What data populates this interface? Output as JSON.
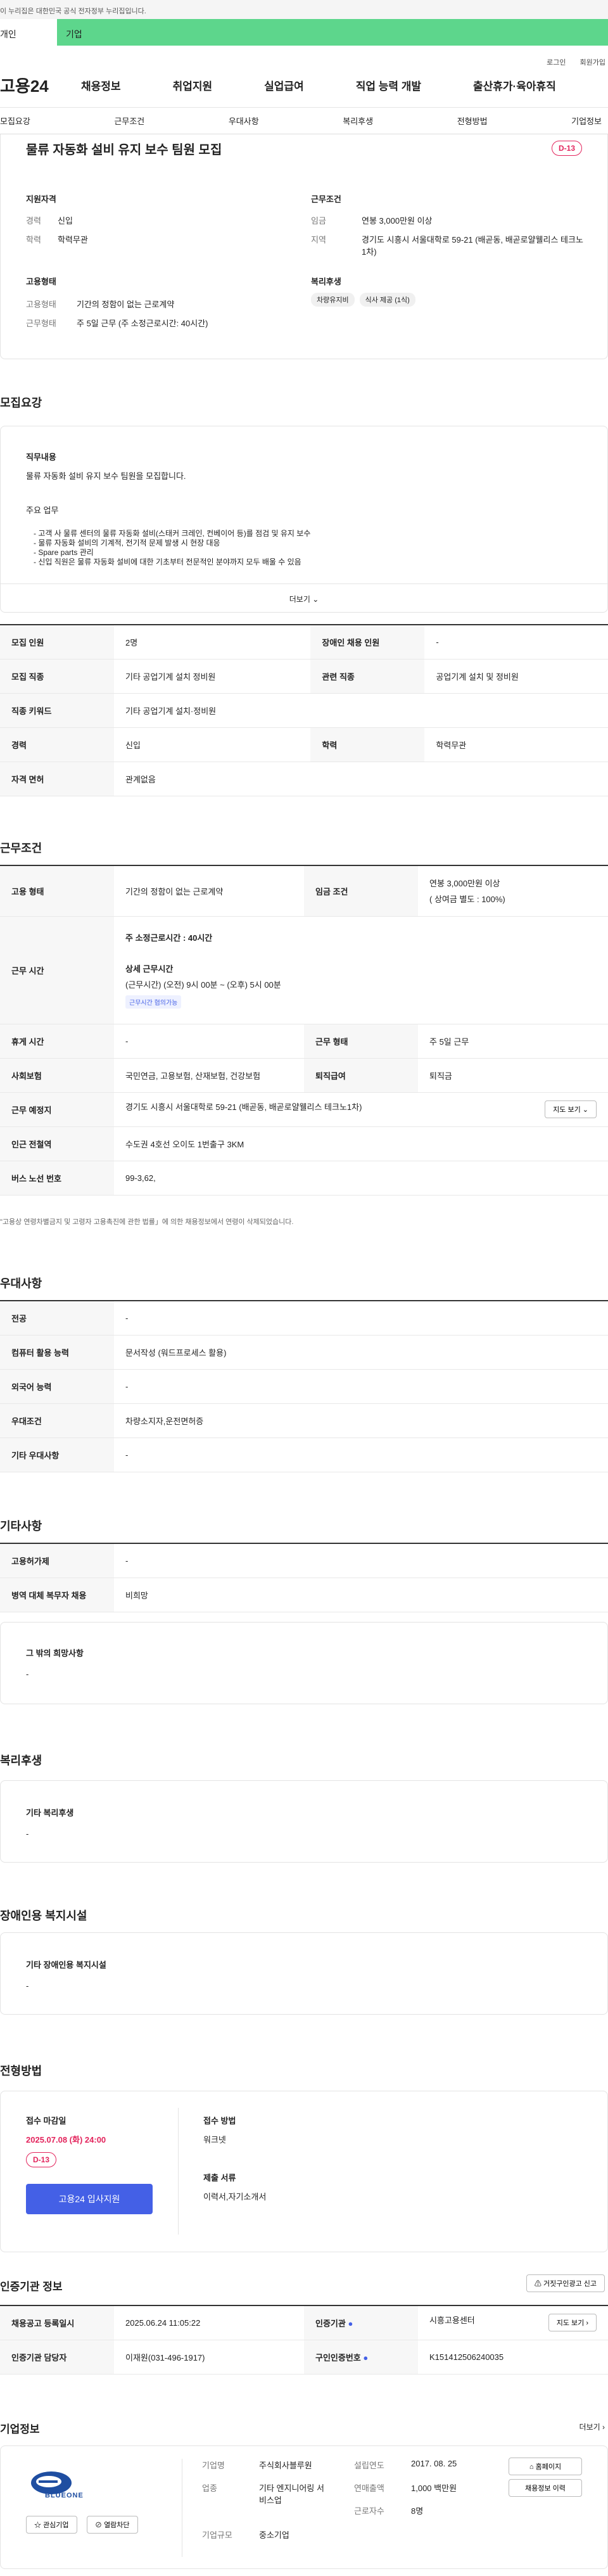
{
  "gov_notice": "이 누리집은 대한민국 공식 전자정부 누리집입니다.",
  "top_tabs": [
    "개인",
    "기업"
  ],
  "util": [
    "로그인",
    "회원가입"
  ],
  "logo": "고용24",
  "gnb": [
    "채용정보",
    "취업지원",
    "실업급여",
    "직업 능력 개발",
    "출산휴가·육아휴직"
  ],
  "subnav": [
    "모집요강",
    "근무조건",
    "우대사항",
    "복리후생",
    "전형방법",
    "기업정보"
  ],
  "summary": {
    "title": "물류 자동화 설비 유지 보수 팀원 모집",
    "dday": "D-13",
    "qual_h": "지원자격",
    "career_k": "경력",
    "career_v": "신입",
    "edu_k": "학력",
    "edu_v": "학력무관",
    "cond_h": "근무조건",
    "wage_k": "임금",
    "wage_v": "연봉 3,000만원 이상",
    "loc_k": "지역",
    "loc_v": "경기도 시흥시 서울대학로 59-21 (배곧동, 배곧로얄웰리스 테크노1차)",
    "emp_h": "고용형태",
    "type_k": "고용형태",
    "type_v": "기간의 정함이 없는 근로계약",
    "hours_k": "근무형태",
    "hours_v": "주 5일 근무 (주 소정근로시간: 40시간)",
    "welf_h": "복리후생",
    "chips": [
      "차량유지비",
      "식사 제공 (1식)"
    ]
  },
  "recruit": {
    "title": "모집요강",
    "duty_h": "직무내용",
    "duty_v": "물류 자동화 설비 유지 보수 팀원을 모집합니다.",
    "main_h": "주요 업무",
    "lines": [
      "- 고객 사 물류 센터의 물류 자동화 설비(스태커 크레인, 컨베이어 등)를 점검 및 유지 보수",
      "- 물류 자동화 설비의 기계적, 전기적 문제 발생 시 현장 대응",
      "- Spare parts 관리",
      "- 신입 직원은 물류 자동화 설비에 대한 기초부터 전문적인 분야까지 모두 배울 수 있음"
    ],
    "more": "더보기",
    "rows": [
      [
        "모집 인원",
        "2명",
        "장애인 채용 인원",
        "-"
      ],
      [
        "모집 직종",
        "기타 공업기계 설치 정비원",
        "관련 직종",
        "공업기계 설치 및 정비원"
      ],
      [
        "직종 키워드",
        "기타 공업기계 설치·정비원",
        "",
        ""
      ],
      [
        "경력",
        "신입",
        "학력",
        "학력무관"
      ],
      [
        "자격 면허",
        "관계없음",
        "",
        ""
      ]
    ]
  },
  "work": {
    "title": "근무조건",
    "type_k": "고용 형태",
    "type_v": "기간의 정함이 없는 근로계약",
    "wage_k": "임금 조건",
    "wage_v1": "연봉 3,000만원 이상",
    "wage_v2": "( 상여금 별도 : 100%)",
    "hours_k": "근무 시간",
    "weekly": "주 소정근로시간 : 40시간",
    "detail_h": "상세 근무시간",
    "detail_v": "(근무시간) (오전) 9시 00분 ~ (오후) 5시 00분",
    "badge": "근무시간 협의가능",
    "rows": [
      [
        "휴게 시간",
        "-",
        "근무 형태",
        "주 5일 근무"
      ],
      [
        "사회보험",
        "국민연금, 고용보험, 산재보험, 건강보험",
        "퇴직급여",
        "퇴직금"
      ]
    ],
    "place_k": "근무 예정지",
    "place_v": "경기도 시흥시 서울대학로 59-21 (배곧동, 배곧로얄웰리스 테크노1차)",
    "map_btn": "지도 보기",
    "sub_k": "인근 전철역",
    "sub_v": "수도권 4호선 오이도 1번출구 3KM",
    "bus_k": "버스 노선 번호",
    "bus_v": "99-3,62,",
    "note": "\"고용상 연령차별금지 및 고령자 고용촉진에 관한 법률」에 의한 채용정보에서 연령이 삭제되었습니다."
  },
  "pref": {
    "title": "우대사항",
    "rows": [
      [
        "전공",
        "-"
      ],
      [
        "컴퓨터 활용 능력",
        "문서작성 (워드프로세스 활용)"
      ],
      [
        "외국어 능력",
        "-"
      ],
      [
        "우대조건",
        "차량소지자,운전면허증"
      ],
      [
        "기타 우대사항",
        "-"
      ]
    ]
  },
  "etc": {
    "title": "기타사항",
    "rows": [
      [
        "고용허가제",
        "-"
      ],
      [
        "병역 대체 복무자 채용",
        "비희망"
      ]
    ],
    "hope_h": "그 밖의 희망사항",
    "hope_v": "-"
  },
  "welfare": {
    "title": "복리후생",
    "box_h": "기타 복리후생",
    "box_v": "-"
  },
  "disab": {
    "title": "장애인용 복지시설",
    "box_h": "기타 장애인용 복지시설",
    "box_v": "-"
  },
  "proc": {
    "title": "전형방법",
    "dl_h": "접수 마감일",
    "dl_v": "2025.07.08 (화) 24:00",
    "dday": "D-13",
    "apply": "고용24 입사지원",
    "how_h": "접수 방법",
    "how_v": "워크넷",
    "doc_h": "제출 서류",
    "doc_v": "이력서,자기소개서"
  },
  "cert": {
    "title": "인증기관 정보",
    "report": "거짓구인광고 신고",
    "reg_k": "채용공고 등록일시",
    "reg_v": "2025.06.24 11:05:22",
    "org_k": "인증기관",
    "org_v": "시흥고용센터",
    "map": "지도 보기",
    "mgr_k": "인증기관 담당자",
    "mgr_v": "이재원(031-496-1917)",
    "no_k": "구인인증번호",
    "no_v": "K151412506240035"
  },
  "company": {
    "title": "기업정보",
    "more": "더보기",
    "logo_text": "BLUEONE",
    "fav": "관심기업",
    "block": "열람차단",
    "name_k": "기업명",
    "name_v": "주식회사블루원",
    "ind_k": "업종",
    "ind_v": "기타 엔지니어링 서비스업",
    "size_k": "기업규모",
    "size_v": "중소기업",
    "est_k": "설립연도",
    "est_v": "2017. 08. 25",
    "sales_k": "연매출액",
    "sales_v": "1,000 백만원",
    "emp_k": "근로자수",
    "emp_v": "8명",
    "home": "홈페이지",
    "history": "채용정보 이력"
  },
  "colors": {
    "accent": "#5dd68c",
    "dday": "#e3245c",
    "primary": "#4460e6"
  }
}
